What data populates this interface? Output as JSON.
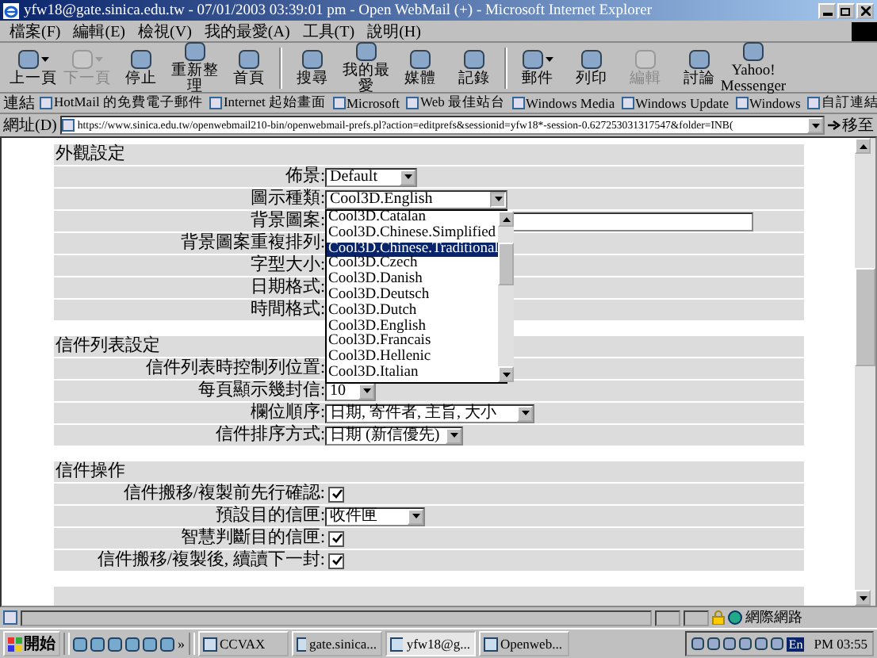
{
  "window": {
    "title": "yfw18@gate.sinica.edu.tw - 07/01/2003 03:39:01 pm - Open WebMail (+) - Microsoft Internet Explorer"
  },
  "menu": [
    "檔案(F)",
    "編輯(E)",
    "檢視(V)",
    "我的最愛(A)",
    "工具(T)",
    "說明(H)"
  ],
  "toolbar": [
    {
      "label": "上一頁",
      "disabled": false,
      "dropdown": true
    },
    {
      "label": "下一頁",
      "disabled": true,
      "dropdown": true
    },
    {
      "label": "停止",
      "disabled": false,
      "dropdown": false
    },
    {
      "label": "重新整理",
      "disabled": false,
      "dropdown": false
    },
    {
      "label": "首頁",
      "disabled": false,
      "dropdown": false
    },
    {
      "label": "搜尋",
      "disabled": false,
      "dropdown": false
    },
    {
      "label": "我的最愛",
      "disabled": false,
      "dropdown": false
    },
    {
      "label": "媒體",
      "disabled": false,
      "dropdown": false
    },
    {
      "label": "記錄",
      "disabled": false,
      "dropdown": false
    },
    {
      "label": "郵件",
      "disabled": false,
      "dropdown": true
    },
    {
      "label": "列印",
      "disabled": false,
      "dropdown": false
    },
    {
      "label": "編輯",
      "disabled": true,
      "dropdown": false
    },
    {
      "label": "討論",
      "disabled": false,
      "dropdown": false
    },
    {
      "label": "Yahoo! Messenger",
      "disabled": false,
      "dropdown": false
    }
  ],
  "links_bar": {
    "label": "連結",
    "links": [
      "HotMail 的免費電子郵件",
      "Internet 起始畫面",
      "Microsoft",
      "Web 最佳站台",
      "Windows Media",
      "Windows Update",
      "Windows",
      "自訂連結"
    ]
  },
  "address_bar": {
    "label": "網址(D)",
    "url": "https://www.sinica.edu.tw/openwebmail210-bin/openwebmail-prefs.pl?action=editprefs&sessionid=yfw18*-session-0.627253031317547&folder=INB(",
    "go": "移至"
  },
  "sections": [
    {
      "title": "外觀設定",
      "rows": [
        {
          "label": "佈景:",
          "kind": "select",
          "value": "Default"
        },
        {
          "label": "圖示種類:",
          "kind": "select",
          "value": "Cool3D.English",
          "open": true
        },
        {
          "label": "背景圖案:",
          "kind": "text"
        },
        {
          "label": "背景圖案重複排列:",
          "kind": "hidden"
        },
        {
          "label": "字型大小:",
          "kind": "hidden"
        },
        {
          "label": "日期格式:",
          "kind": "hidden"
        },
        {
          "label": "時間格式:",
          "kind": "hidden"
        }
      ]
    },
    {
      "title": "信件列表設定",
      "rows": [
        {
          "label": "信件列表時控制列位置:",
          "kind": "hidden"
        },
        {
          "label": "每頁顯示幾封信:",
          "kind": "select",
          "value": "10"
        },
        {
          "label": "欄位順序:",
          "kind": "select",
          "value": "日期, 寄件者, 主旨, 大小"
        },
        {
          "label": "信件排序方式:",
          "kind": "select",
          "value": "日期 (新信優先)"
        }
      ]
    },
    {
      "title": "信件操作",
      "rows": [
        {
          "label": "信件搬移/複製前先行確認:",
          "kind": "checkbox",
          "checked": true
        },
        {
          "label": "預設目的信匣:",
          "kind": "select",
          "value": "收件匣"
        },
        {
          "label": "智慧判斷目的信匣:",
          "kind": "checkbox",
          "checked": true
        },
        {
          "label": "信件搬移/複製後, 續讀下一封:",
          "kind": "checkbox",
          "checked": true
        }
      ]
    }
  ],
  "dropdown_list": [
    {
      "label": "Cool3D.Catalan",
      "selected": false
    },
    {
      "label": "Cool3D.Chinese.Simplified",
      "selected": false
    },
    {
      "label": "Cool3D.Chinese.Traditional",
      "selected": true
    },
    {
      "label": "Cool3D.Czech",
      "selected": false
    },
    {
      "label": "Cool3D.Danish",
      "selected": false
    },
    {
      "label": "Cool3D.Deutsch",
      "selected": false
    },
    {
      "label": "Cool3D.Dutch",
      "selected": false
    },
    {
      "label": "Cool3D.English",
      "selected": false
    },
    {
      "label": "Cool3D.Francais",
      "selected": false
    },
    {
      "label": "Cool3D.Hellenic",
      "selected": false
    },
    {
      "label": "Cool3D.Italian",
      "selected": false
    }
  ],
  "status_bar": {
    "zone": "網際網路"
  },
  "taskbar": {
    "start": "開始",
    "more": "»",
    "tasks": [
      {
        "label": "CCVAX",
        "selected": false
      },
      {
        "label": "gate.sinica...",
        "selected": false
      },
      {
        "label": "yfw18@g...",
        "selected": true
      },
      {
        "label": "Openweb...",
        "selected": false
      }
    ],
    "language": "En",
    "clock": "PM 03:55"
  }
}
